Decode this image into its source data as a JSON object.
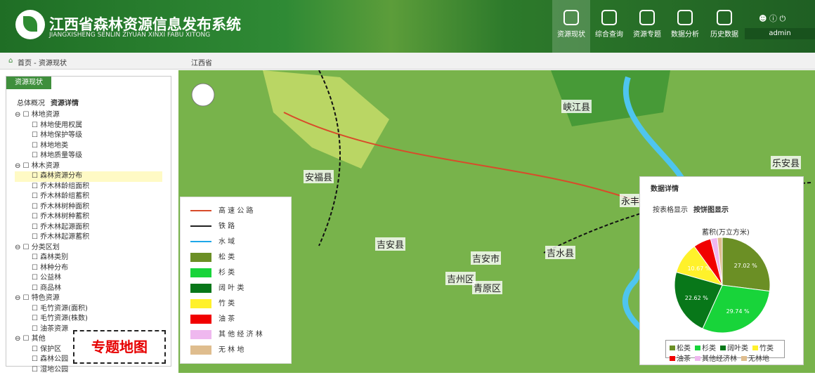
{
  "header": {
    "title": "江西省森林资源信息发布系统",
    "subtitle": "JIANGXISHENG SENLIN ZIYUAN XINXI FABU XITONG",
    "user": "admin"
  },
  "nav": [
    {
      "label": "资源现状"
    },
    {
      "label": "综合查询"
    },
    {
      "label": "资源专题"
    },
    {
      "label": "数据分析"
    },
    {
      "label": "历史数据"
    }
  ],
  "breadcrumb": "首页 - 资源现状",
  "region": "江西省",
  "sidebar": {
    "tab": "资源现状",
    "subtabs": [
      "总体概况",
      "资源详情"
    ],
    "tree": [
      {
        "label": "林地资源",
        "level": 0
      },
      {
        "label": "林地使用权属",
        "level": 1
      },
      {
        "label": "林地保护等级",
        "level": 1
      },
      {
        "label": "林地地类",
        "level": 1
      },
      {
        "label": "林地质量等级",
        "level": 1
      },
      {
        "label": "林木资源",
        "level": 0
      },
      {
        "label": "森林资源分布",
        "level": 1
      },
      {
        "label": "乔木林龄组面积",
        "level": 1
      },
      {
        "label": "乔木林龄组蓄积",
        "level": 1
      },
      {
        "label": "乔木林树种面积",
        "level": 1
      },
      {
        "label": "乔木林树种蓄积",
        "level": 1
      },
      {
        "label": "乔木林起源面积",
        "level": 1
      },
      {
        "label": "乔木林起源蓄积",
        "level": 1
      },
      {
        "label": "分类区划",
        "level": 0
      },
      {
        "label": "森林类别",
        "level": 1
      },
      {
        "label": "林种分布",
        "level": 1
      },
      {
        "label": "公益林",
        "level": 1
      },
      {
        "label": "商品林",
        "level": 1
      },
      {
        "label": "特色资源",
        "level": 0
      },
      {
        "label": "毛竹资源(面积)",
        "level": 1
      },
      {
        "label": "毛竹资源(株数)",
        "level": 1
      },
      {
        "label": "油茶资源",
        "level": 1
      },
      {
        "label": "其他",
        "level": 0
      },
      {
        "label": "保护区",
        "level": 1
      },
      {
        "label": "森林公园",
        "level": 1
      },
      {
        "label": "湿地公园",
        "level": 1
      }
    ],
    "annotation": "专题地图"
  },
  "map": {
    "labels": [
      "峡江县",
      "安福县",
      "永丰",
      "乐安县",
      "吉安县",
      "吉安市",
      "吉州区",
      "青原区",
      "吉水县"
    ]
  },
  "legend": [
    {
      "label": "高 速 公 路",
      "color": "#d84b2a"
    },
    {
      "label": "铁 路",
      "color": "#222"
    },
    {
      "label": "水 域",
      "color": "#1ea7e8"
    },
    {
      "label": "松 类",
      "color": "#6b8f25"
    },
    {
      "label": "杉 类",
      "color": "#18d43a"
    },
    {
      "label": "阔 叶 类",
      "color": "#087719"
    },
    {
      "label": "竹 类",
      "color": "#fff12b"
    },
    {
      "label": "油 茶",
      "color": "#f10000"
    },
    {
      "label": "其 他 经 济 林",
      "color": "#efb8ef"
    },
    {
      "label": "无 林 地",
      "color": "#dfbd8e"
    }
  ],
  "data_card": {
    "title": "数据详情",
    "tabs": [
      "按表格显示",
      "按饼图显示"
    ],
    "chart_data": {
      "type": "pie",
      "title": "蓄积(万立方米)",
      "values": [
        27.02,
        29.74,
        22.62,
        10.67,
        6.0,
        2.3,
        1.65
      ],
      "labels": [
        "松类",
        "杉类",
        "阔叶类",
        "竹类",
        "油茶",
        "其他经济林",
        "无林地"
      ],
      "slice_labels": [
        "27.02 %",
        "29.74 %",
        "22.62 %",
        "10.67 %",
        "",
        "",
        ""
      ],
      "colors": [
        "#6b8f25",
        "#18d43a",
        "#087719",
        "#fff12b",
        "#f10000",
        "#efb8ef",
        "#dfbd8e"
      ]
    }
  }
}
